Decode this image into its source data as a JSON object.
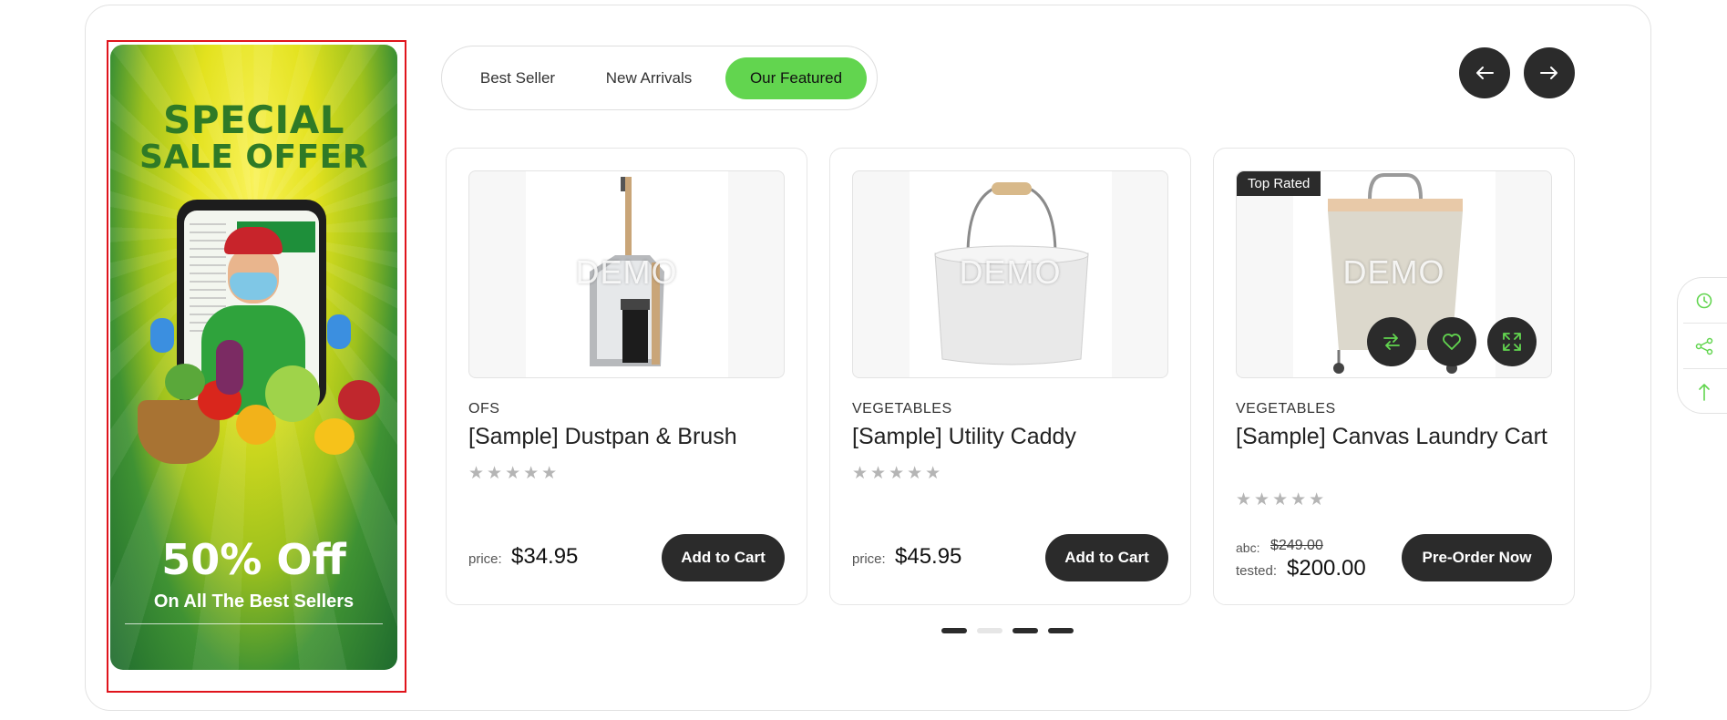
{
  "banner": {
    "line1": "SPECIAL",
    "line2": "SALE OFFER",
    "discount": "50% Off",
    "subline": "On All The Best Sellers"
  },
  "tabs": [
    {
      "label": "Best Seller",
      "active": false
    },
    {
      "label": "New Arrivals",
      "active": false
    },
    {
      "label": "Our Featured",
      "active": true
    }
  ],
  "nav": {
    "prev_icon": "arrow-left-icon",
    "next_icon": "arrow-right-icon"
  },
  "products": [
    {
      "image_watermark": "DEMO",
      "category": "OFS",
      "name": "[Sample] Dustpan & Brush",
      "rating": "0 of 5",
      "price_label": "price:",
      "price": "$34.95",
      "button": "Add to Cart"
    },
    {
      "image_watermark": "DEMO",
      "category": "VEGETABLES",
      "name": "[Sample] Utility Caddy",
      "rating": "0 of 5",
      "price_label": "price:",
      "price": "$45.95",
      "button": "Add to Cart"
    },
    {
      "badge": "Top Rated",
      "image_watermark": "DEMO",
      "category": "VEGETABLES",
      "name": "[Sample] Canvas Laundry Cart",
      "rating": "0 of 5",
      "old_label": "abc:",
      "old_price": "$249.00",
      "new_label": "tested:",
      "new_price": "$200.00",
      "button": "Pre-Order Now",
      "actions": [
        "compare-icon",
        "heart-icon",
        "expand-icon"
      ]
    }
  ],
  "pager": {
    "count": 4,
    "active_index": 1
  },
  "side_tools": [
    "recent-history-icon",
    "share-icon",
    "back-to-top-icon"
  ],
  "colors": {
    "accent": "#62d54f",
    "dark": "#2b2b2b",
    "highlight_box": "#e0141c"
  }
}
